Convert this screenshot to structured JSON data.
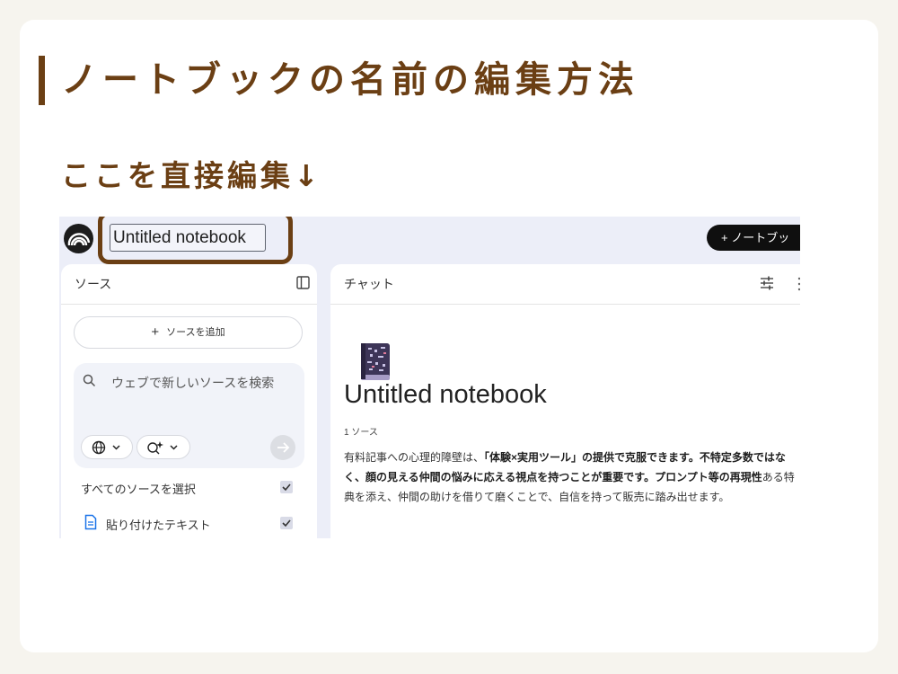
{
  "heading": "ノートブックの名前の編集方法",
  "subheading": "ここを直接編集↓",
  "app": {
    "notebook_title_input": "Untitled notebook",
    "new_notebook_label": "+ ノートブッ"
  },
  "sources_panel": {
    "title": "ソース",
    "add_source_label": "ソースを追加",
    "add_source_icon": "+",
    "search_text": "ウェブで新しいソースを検索",
    "select_all_label": "すべてのソースを選択",
    "items": [
      {
        "label": "貼り付けたテキスト",
        "checked": true
      }
    ]
  },
  "chat_panel": {
    "title": "チャット",
    "notebook_title": "Untitled notebook",
    "source_count": "1 ソース",
    "summary": {
      "s1": "有料記事への心理的障壁は、",
      "s2": "「体験×実用ツール」の提供で克服できます。不特定多数ではなく、顔の見える仲間の悩みに応える視点を持つことが重要です。プロンプト等の再現性",
      "s3": "ある特典を添え、仲間の助けを借りて磨くことで、自信を持って販売に踏み出せます。"
    }
  },
  "colors": {
    "accent_brown": "#6b3f14",
    "app_bg": "#eceef8"
  }
}
